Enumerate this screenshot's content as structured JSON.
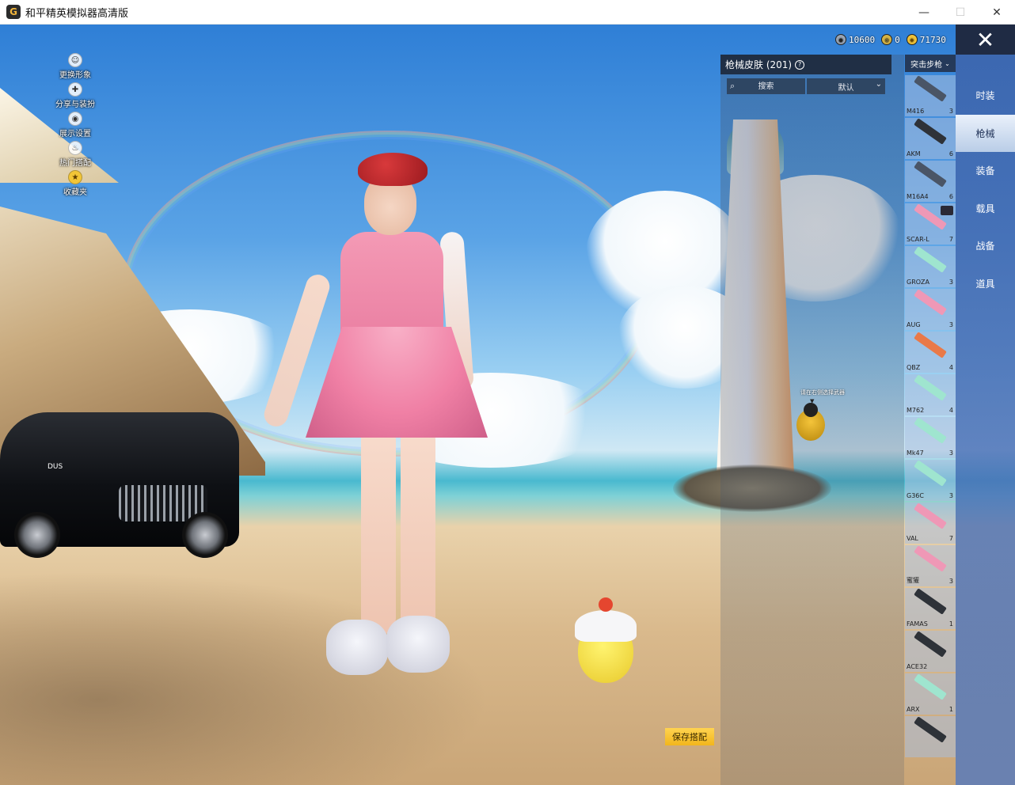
{
  "window": {
    "title": "和平精英模拟器高清版",
    "app_icon_letter": "G",
    "minimize_symbol": "—",
    "maximize_symbol": "☐",
    "close_symbol": "✕"
  },
  "left_menu": {
    "items": [
      {
        "label": "更换形象",
        "icon": "user-icon"
      },
      {
        "label": "分享与装扮",
        "icon": "share-icon"
      },
      {
        "label": "展示设置",
        "icon": "eye-icon"
      },
      {
        "label": "热门搭配",
        "icon": "flame-icon"
      },
      {
        "label": "收藏夹",
        "icon": "star-icon"
      }
    ]
  },
  "currency": {
    "items": [
      {
        "value": "10600",
        "icon": "coin-gray-icon"
      },
      {
        "value": "0",
        "icon": "coin-ring-icon"
      },
      {
        "value": "71730",
        "icon": "coin-gold-icon"
      }
    ]
  },
  "close_button": {
    "symbol": "✕"
  },
  "categories": {
    "items": [
      {
        "label": "时装",
        "active": false
      },
      {
        "label": "枪械",
        "active": true
      },
      {
        "label": "装备",
        "active": false
      },
      {
        "label": "载具",
        "active": false
      },
      {
        "label": "战备",
        "active": false
      },
      {
        "label": "道具",
        "active": false
      }
    ]
  },
  "panel": {
    "title": "枪械皮肤 (201)",
    "help_symbol": "?",
    "search_placeholder": "搜索",
    "sort_label": "默认",
    "hint": "请在右侧选择武器",
    "weapon_type": "突击步枪"
  },
  "weapons": [
    {
      "name": "M416",
      "count": "3",
      "color": "gray"
    },
    {
      "name": "AKM",
      "count": "6",
      "color": "dark"
    },
    {
      "name": "M16A4",
      "count": "6",
      "color": "gray"
    },
    {
      "name": "SCAR-L",
      "count": "7",
      "color": "pink"
    },
    {
      "name": "GROZA",
      "count": "3",
      "color": "teal"
    },
    {
      "name": "AUG",
      "count": "3",
      "color": "pink"
    },
    {
      "name": "QBZ",
      "count": "4",
      "color": "orange"
    },
    {
      "name": "M762",
      "count": "4",
      "color": "teal"
    },
    {
      "name": "Mk47",
      "count": "3",
      "color": "teal"
    },
    {
      "name": "G36C",
      "count": "3",
      "color": "teal"
    },
    {
      "name": "VAL",
      "count": "7",
      "color": "pink"
    },
    {
      "name": "蜜獾",
      "count": "3",
      "color": "pink"
    },
    {
      "name": "FAMAS",
      "count": "1",
      "color": "dark"
    },
    {
      "name": "ACE32",
      "count": "",
      "color": "dark"
    },
    {
      "name": "ARX",
      "count": "1",
      "color": "teal"
    },
    {
      "name": "",
      "count": "",
      "color": "dark"
    }
  ],
  "save_button": {
    "label": "保存搭配"
  },
  "scene": {
    "car_plate": "DUS"
  }
}
